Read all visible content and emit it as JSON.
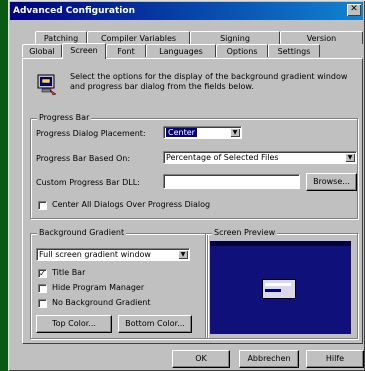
{
  "window": {
    "title": "Advanced Configuration",
    "close_glyph": "✕"
  },
  "tabs_row1": [
    {
      "label": "Patching"
    },
    {
      "label": "Compiler Variables"
    },
    {
      "label": "Signing"
    },
    {
      "label": "Version"
    }
  ],
  "tabs_row2": [
    {
      "label": "Global"
    },
    {
      "label": "Screen"
    },
    {
      "label": "Font"
    },
    {
      "label": "Languages"
    },
    {
      "label": "Options"
    },
    {
      "label": "Settings"
    }
  ],
  "active_tab": "Screen",
  "intro_text": "Select the options for the display of the background gradient window and progress bar dialog from the fields below.",
  "progress_bar": {
    "group_title": "Progress Bar",
    "placement_label": "Progress Dialog Placement:",
    "placement_value": "Center",
    "based_on_label": "Progress Bar Based On:",
    "based_on_value": "Percentage of Selected Files",
    "dll_label": "Custom Progress Bar DLL:",
    "dll_value": "",
    "browse_button": "Browse...",
    "center_all_label": "Center All Dialogs Over Progress Dialog",
    "center_all_checked": false
  },
  "background_gradient": {
    "group_title": "Background Gradient",
    "window_value": "Full screen gradient window",
    "title_bar_label": "Title Bar",
    "title_bar_checked": true,
    "hide_pm_label": "Hide Program Manager",
    "hide_pm_checked": false,
    "no_bg_label": "No Background Gradient",
    "no_bg_checked": false,
    "top_color_button": "Top Color...",
    "bottom_color_button": "Bottom Color..."
  },
  "screen_preview": {
    "group_title": "Screen Preview",
    "background_color": "#10107a"
  },
  "footer": {
    "ok": "OK",
    "cancel": "Abbrechen",
    "help": "Hilfe"
  }
}
